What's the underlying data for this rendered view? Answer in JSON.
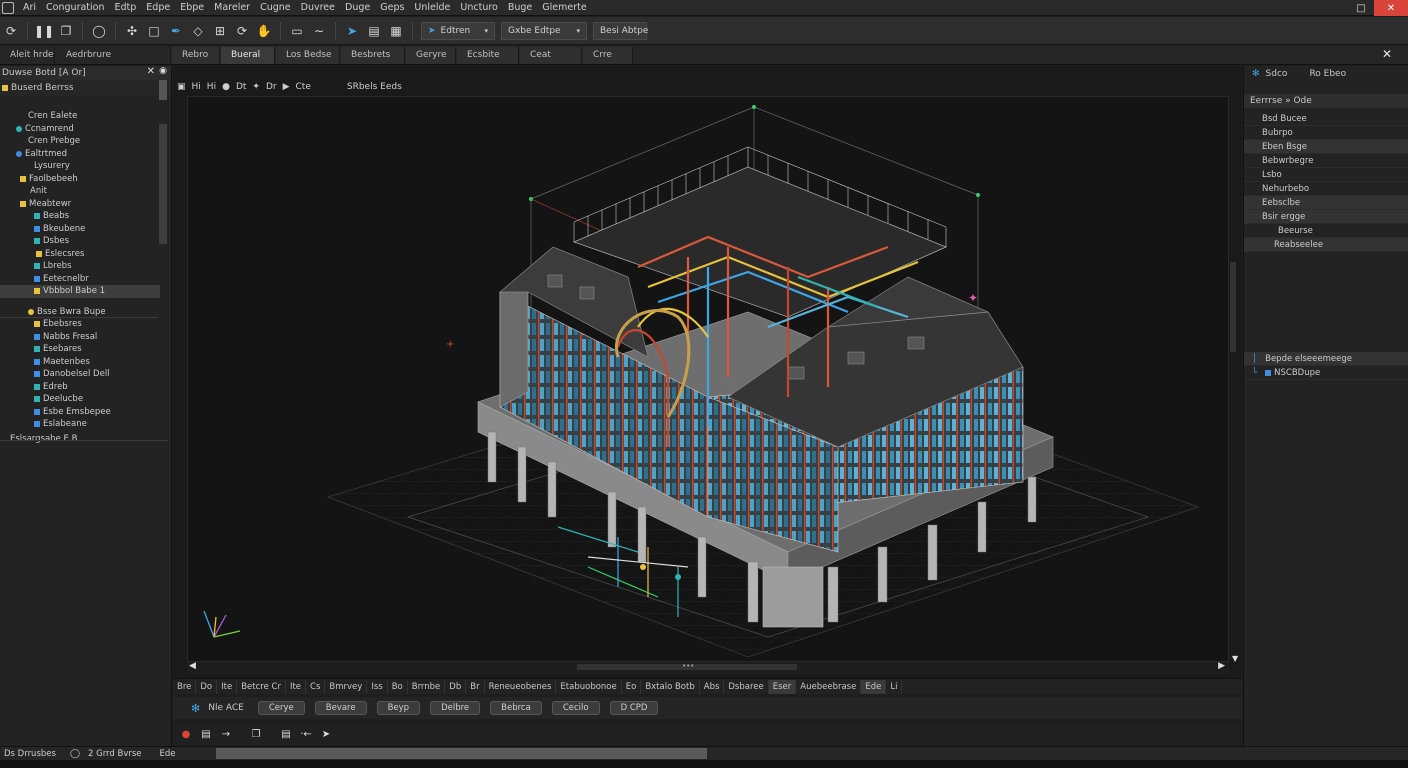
{
  "menubar": {
    "items": [
      "Ari",
      "Conguration",
      "Edtp",
      "Edpe",
      "Ebpe",
      "Mareler",
      "Cugne",
      "Duvree",
      "Duge",
      "Geps",
      "Unlelde",
      "Uncturo",
      "Buge",
      "Glemerte"
    ]
  },
  "toolbar": {
    "field1": "Edtren",
    "field2": "Gxbe  Edtpe",
    "field3": "Besi  Abtpe"
  },
  "tabs": {
    "items": [
      "Aleit hrde",
      "Aedrbrure",
      "Rebro",
      "Bueral",
      "Los Bedse",
      "Besbrets",
      "Geryre",
      "Ecsbite",
      "Ceat",
      "Crre"
    ],
    "active_index": 3
  },
  "left_panel": {
    "header": "Duwse  Botd  [A  Or]",
    "filter": "Buserd  Berrss",
    "tree": [
      {
        "label": "Cren Ealete",
        "indent": 28,
        "icon": "none",
        "color": ""
      },
      {
        "label": "Ccnamrend",
        "indent": 16,
        "icon": "dot",
        "color": "#2fb3b3"
      },
      {
        "label": "Cren Prebge",
        "indent": 28,
        "icon": "none",
        "color": ""
      },
      {
        "label": "Ealtrtmed",
        "indent": 16,
        "icon": "dot",
        "color": "#3e8ee6"
      },
      {
        "label": "Lysurery",
        "indent": 34,
        "icon": "none",
        "color": ""
      },
      {
        "label": "Faolbebeeh",
        "indent": 20,
        "icon": "sq",
        "color": "#e8c23a"
      },
      {
        "label": "Anit",
        "indent": 30,
        "icon": "none",
        "color": ""
      },
      {
        "label": "Meabtewr",
        "indent": 20,
        "icon": "sq",
        "color": "#e8c23a"
      },
      {
        "label": "Beabs",
        "indent": 34,
        "icon": "sq",
        "color": "#2fb3b3"
      },
      {
        "label": "Bkeubene",
        "indent": 34,
        "icon": "sq",
        "color": "#3e8ee6"
      },
      {
        "label": "Dsbes",
        "indent": 34,
        "icon": "sq",
        "color": "#2fb3b3"
      },
      {
        "label": "Eslecsres",
        "indent": 36,
        "icon": "sq",
        "color": "#e8c23a"
      },
      {
        "label": "Lbrebs",
        "indent": 34,
        "icon": "sq",
        "color": "#2fb3b3"
      },
      {
        "label": "Eetecnelbr",
        "indent": 34,
        "icon": "sq",
        "color": "#3e8ee6"
      },
      {
        "label": "Vbbbol Babe  1",
        "indent": 34,
        "icon": "sq",
        "color": "#e8c23a",
        "selected": true
      },
      {
        "label": "Bsse Bwra Bupe",
        "indent": 28,
        "icon": "dot",
        "color": "#e8c23a"
      },
      {
        "label": "Ebebsres",
        "indent": 34,
        "icon": "sq",
        "color": "#e8c23a"
      },
      {
        "label": "Nabbs Fresal",
        "indent": 34,
        "icon": "sq",
        "color": "#3e8ee6"
      },
      {
        "label": "Esebares",
        "indent": 34,
        "icon": "sq",
        "color": "#2fb3b3"
      },
      {
        "label": "Maetenbes",
        "indent": 34,
        "icon": "sq",
        "color": "#3e8ee6"
      },
      {
        "label": "Danobelsel Dell",
        "indent": 34,
        "icon": "sq",
        "color": "#3e8ee6"
      },
      {
        "label": "Edreb",
        "indent": 34,
        "icon": "sq",
        "color": "#2fb3b3"
      },
      {
        "label": "Deelucbe",
        "indent": 34,
        "icon": "sq",
        "color": "#2fb3b3"
      },
      {
        "label": "Esbe Emsbepee",
        "indent": 34,
        "icon": "sq",
        "color": "#3e8ee6"
      },
      {
        "label": "Eslabeane",
        "indent": 34,
        "icon": "sq",
        "color": "#3e8ee6"
      },
      {
        "label": "Eslsargsabe  E.B",
        "indent": 10,
        "icon": "none",
        "color": ""
      }
    ]
  },
  "viewport": {
    "toolbar": [
      "Hi",
      "Hi",
      "Dt",
      "Dr",
      "Cte",
      "SRbels Eeds"
    ]
  },
  "right_panel": {
    "header1": "Sdco",
    "header2": "Ro Ebeo",
    "filter": "Eerrrse  »  Ode",
    "rows": [
      {
        "label": "Bsd Bucee",
        "indent": 18
      },
      {
        "label": "Bubrpo",
        "indent": 18
      },
      {
        "label": "Eben Bsge",
        "indent": 18
      },
      {
        "label": "Bebwrbegre",
        "indent": 18
      },
      {
        "label": "Lsbo",
        "indent": 18
      },
      {
        "label": "Nehurbebo",
        "indent": 18
      },
      {
        "label": "Eebsclbe",
        "indent": 18
      },
      {
        "label": "Bsir ergge",
        "indent": 18
      },
      {
        "label": "Beeurse",
        "indent": 34
      },
      {
        "label": "Reabseelee",
        "indent": 30
      }
    ],
    "bottom_rows": [
      "Bepde elseeemeege",
      "NSCBDupe"
    ]
  },
  "bottom_bar1": {
    "cells": [
      "Bre",
      "Do",
      "Ite",
      "Betcre Cr",
      "Ite",
      "Cs",
      "Bmrvey",
      "Iss",
      "Bo",
      "Brrnbe",
      "Db",
      "Br",
      "Reneueobenes",
      "Etabuobonoe",
      "Eo",
      "Bxtalo Botb",
      "Abs",
      "Dsbaree",
      "Eser",
      "Auebeebrase",
      "Ede",
      "Li"
    ]
  },
  "bottom_bar2": {
    "lead": "Nle  ACE",
    "pills": [
      "Cerye",
      "Bevare",
      "Beyp",
      "Delbre",
      "Bebrca",
      "Cecilo",
      "D CPD"
    ]
  },
  "statusbar": {
    "seg1": "Ds Drrusbes",
    "seg2": "2 Grrd  Bvrse",
    "seg3": "Ede"
  },
  "colors": {
    "accent_blue": "#3fa6e6",
    "accent_yellow": "#e8c23a",
    "accent_teal": "#2fb3b3",
    "close_red": "#d9443a"
  }
}
